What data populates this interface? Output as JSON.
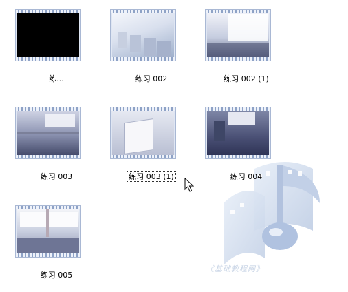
{
  "watermark": {
    "text": "《基础教程网》"
  },
  "files": [
    {
      "label": "练...",
      "selected": false
    },
    {
      "label": "练习 002",
      "selected": false
    },
    {
      "label": "练习 002 (1)",
      "selected": false
    },
    {
      "label": "练习 003",
      "selected": false
    },
    {
      "label": "练习 003 (1)",
      "selected": true
    },
    {
      "label": "练习 004",
      "selected": false
    },
    {
      "label": "练习 005",
      "selected": false
    }
  ]
}
